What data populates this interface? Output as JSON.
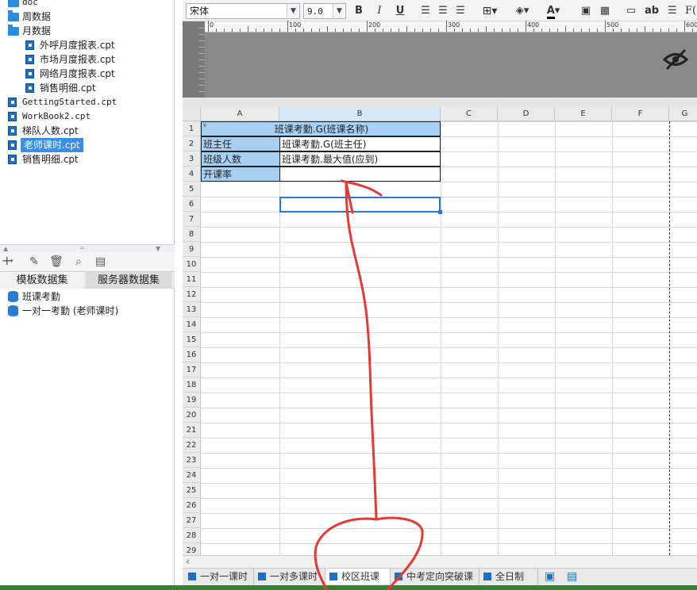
{
  "tree": {
    "items": [
      {
        "label": "doc",
        "type": "folder",
        "indent": 0
      },
      {
        "label": "周数据",
        "type": "folder",
        "indent": 0
      },
      {
        "label": "月数据",
        "type": "folder-open",
        "indent": 0
      },
      {
        "label": "外呼月度报表.cpt",
        "type": "file",
        "indent": 1
      },
      {
        "label": "市场月度报表.cpt",
        "type": "file",
        "indent": 1
      },
      {
        "label": "网络月度报表.cpt",
        "type": "file",
        "indent": 1
      },
      {
        "label": "销售明细.cpt",
        "type": "file",
        "indent": 1
      },
      {
        "label": "GettingStarted.cpt",
        "type": "file",
        "indent": 0
      },
      {
        "label": "WorkBook2.cpt",
        "type": "file",
        "indent": 0
      },
      {
        "label": "梯队人数.cpt",
        "type": "file",
        "indent": 0
      },
      {
        "label": "老师课时.cpt",
        "type": "file",
        "indent": 0,
        "selected": true
      },
      {
        "label": "销售明细.cpt",
        "type": "file",
        "indent": 0
      }
    ]
  },
  "dataset_tabs": {
    "template": "模板数据集",
    "server": "服务器数据集"
  },
  "datasets": [
    "班课考勤",
    "一对一考勤 (老师课时)"
  ],
  "toolbar": {
    "font": "宋体",
    "size": "9.0",
    "bold": "B",
    "italic": "I",
    "underline": "U",
    "text_ab": "ab",
    "text_f": "F("
  },
  "ruler": {
    "labels": [
      "0",
      "100",
      "200",
      "300",
      "400",
      "500",
      "600"
    ]
  },
  "columns": [
    "A",
    "B",
    "C",
    "D",
    "E",
    "F",
    "G"
  ],
  "rows": [
    "1",
    "2",
    "3",
    "4",
    "5",
    "6",
    "7",
    "8",
    "9",
    "10",
    "11",
    "12",
    "13",
    "14",
    "15",
    "16",
    "17",
    "18",
    "19",
    "20",
    "21",
    "22",
    "23",
    "24",
    "25",
    "26",
    "27",
    "28",
    "29"
  ],
  "cells": {
    "r1": "班课考勤.G(班课名称)",
    "r2a": "班主任",
    "r2b": "班课考勤.G(班主任)",
    "r3a": "班级人数",
    "r3b": "班课考勤.最大值(应到)",
    "r4a": "开课率",
    "r4b": ""
  },
  "sheet_tabs": [
    "一对一课时",
    "一对多课时",
    "校区班课",
    "中考定向突破课",
    "全日制"
  ],
  "active_sheet": 2,
  "colors": {
    "accent": "#2a75d6",
    "header_blue": "#a8d0f5",
    "annotation": "#e53935"
  }
}
